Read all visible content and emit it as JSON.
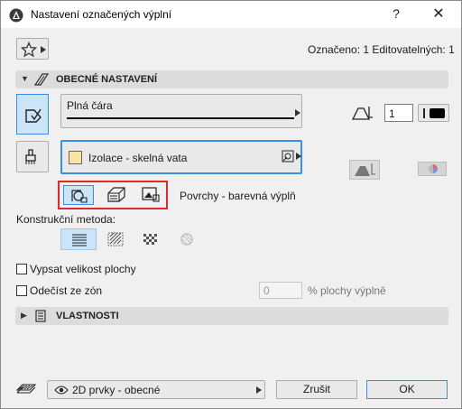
{
  "window": {
    "title": "Nastavení označených výplní",
    "help_label": "?",
    "close_label": "✕"
  },
  "top": {
    "selection_info": "Označeno: 1 Editovatelných: 1"
  },
  "general_section": {
    "label": "OBECNÉ NASTAVENÍ",
    "line_type": "Plná čára",
    "pen_number": "1",
    "fill_name": "Izolace - skelná vata",
    "fill_swatch_color": "#fbe3a6",
    "surface_label": "Povrchy - barevná výplň",
    "construction_method_label": "Konstrukční metoda:",
    "show_area_label": "Vypsat velikost plochy",
    "subtract_zones_label": "Odečíst ze zón",
    "percent_value": "0",
    "percent_suffix": "% plochy výplně"
  },
  "properties_section": {
    "label": "VLASTNOSTI"
  },
  "bottom": {
    "layer_value": "2D prvky - obecné",
    "cancel_label": "Zrušit",
    "ok_label": "OK"
  },
  "colors": {
    "highlight_red": "#e0282e",
    "selected_blue": "#cce4f7",
    "selected_border": "#3a8ee6"
  }
}
